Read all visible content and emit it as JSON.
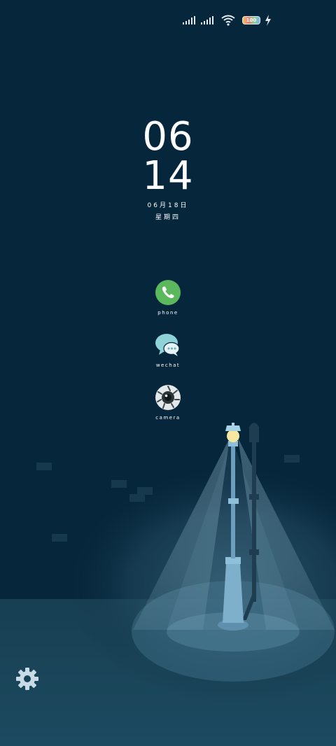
{
  "status_bar": {
    "signal_1_icon": "signal-bars-icon",
    "signal_2_icon": "signal-bars-icon",
    "wifi_icon": "wifi-icon",
    "battery_level": "100",
    "charging_icon": "lightning-bolt-icon"
  },
  "clock": {
    "hour": "06",
    "minute": "14",
    "date": "06月18日",
    "weekday": "星期四"
  },
  "shortcuts": [
    {
      "label": "phone",
      "icon": "phone-icon",
      "color": "#5cb85c"
    },
    {
      "label": "wechat",
      "icon": "chat-bubbles-icon",
      "color": "#8fd3d8"
    },
    {
      "label": "camera",
      "icon": "camera-lens-icon",
      "color": "#e4e8ea"
    }
  ],
  "settings": {
    "icon": "gear-icon"
  },
  "colors": {
    "background": "#06263b",
    "ground": "#1b4357",
    "lamp_post": "#6a9ebc",
    "lamp_light": "#f6e7a1"
  }
}
